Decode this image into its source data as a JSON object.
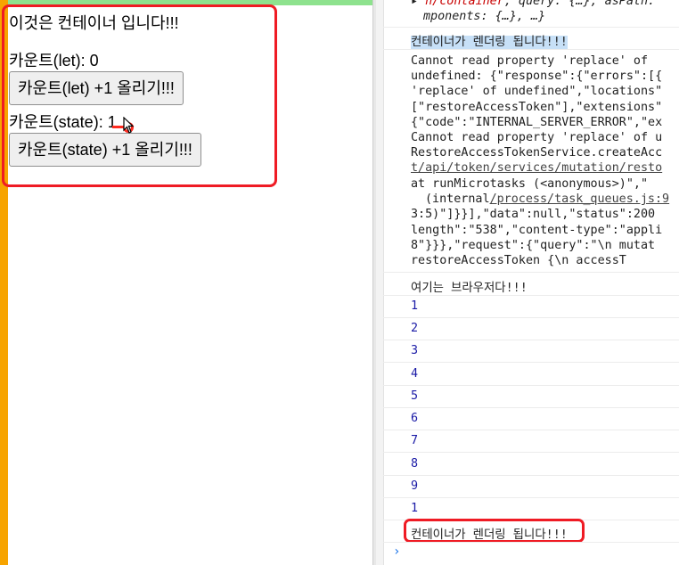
{
  "app": {
    "heading": "이것은 컨테이너 입니다!!!",
    "count_let_label": "카운트(let): 0",
    "count_let_button": "카운트(let) +1 올리기!!!",
    "count_state_label": "카운트(state): 1",
    "count_state_button": "카운트(state) +1 올리기!!!"
  },
  "console": {
    "obj_line1_prefix": "▸ ",
    "obj_line1_key": "n/container",
    "obj_line1_rest": ", query: {…}, asPath:",
    "obj_line2": "mponents: {…}, …}",
    "render_msg_1": "컨테이너가 렌더링 됩니다!!!",
    "error_lines": [
      "Cannot read property 'replace' of",
      "undefined: {\"response\":{\"errors\":[{",
      "'replace' of undefined\",\"locations\"",
      "[\"restoreAccessToken\"],\"extensions\"",
      "{\"code\":\"INTERNAL_SERVER_ERROR\",\"ex",
      "Cannot read property 'replace' of u",
      "RestoreAccessTokenService.createAcc"
    ],
    "error_link_1": "t/api/token/services/mutation/resto",
    "error_line_micro": "at runMicrotasks (<anonymous>)\",\"",
    "error_line_internal_prefix": "(internal",
    "error_link_2": "/process/task_queues.js:9",
    "error_tail_lines": [
      "3:5)\"]}}],\"data\":null,\"status\":200",
      "length\":\"538\",\"content-type\":\"appli",
      "8\"}}},\"request\":{\"query\":\"\\n  mutat",
      "restoreAccessToken {\\n      accessT"
    ],
    "browser_msg": "여기는 브라우저다!!!",
    "numbers": [
      "1",
      "2",
      "3",
      "4",
      "5",
      "6",
      "7",
      "8",
      "9",
      "1"
    ],
    "render_msg_2": "컨테이너가 렌더링 됩니다!!!",
    "prompt": "›"
  },
  "colors": {
    "annotation_red": "#ef1b24",
    "number_blue": "#1a1aa6",
    "left_strip_orange": "#f7a400",
    "top_strip_green": "#8ee28e"
  }
}
